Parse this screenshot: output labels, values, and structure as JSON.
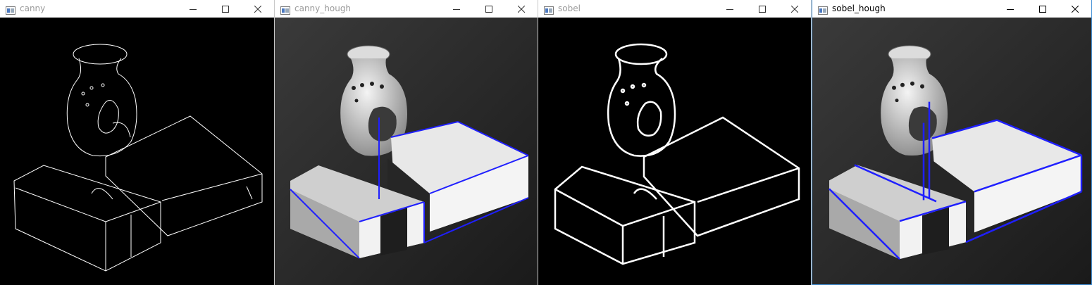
{
  "windows": [
    {
      "title": "canny",
      "active": false,
      "content": "canny edge map"
    },
    {
      "title": "canny_hough",
      "active": false,
      "content": "grayscale with hough lines"
    },
    {
      "title": "sobel",
      "active": false,
      "content": "sobel edge map"
    },
    {
      "title": "sobel_hough",
      "active": true,
      "content": "grayscale with hough lines"
    }
  ],
  "controls": {
    "minimize": "minimize",
    "maximize": "maximize",
    "close": "close"
  },
  "colors": {
    "hough_line": "#1f1fff",
    "active_border": "#3e8ed6",
    "title_inactive": "#9a9a9a",
    "title_active": "#000000"
  }
}
